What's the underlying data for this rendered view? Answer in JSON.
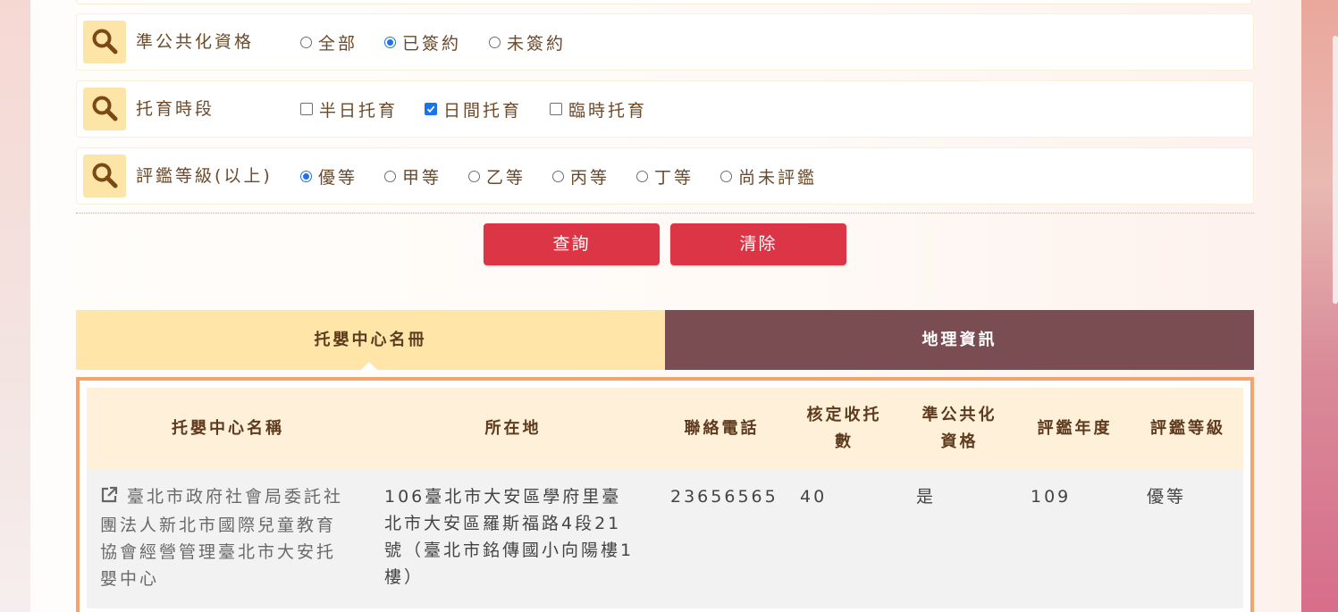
{
  "filters": [
    {
      "label": "準公共化資格",
      "type": "radio",
      "options": [
        {
          "label": "全部",
          "checked": false
        },
        {
          "label": "已簽約",
          "checked": true
        },
        {
          "label": "未簽約",
          "checked": false
        }
      ]
    },
    {
      "label": "托育時段",
      "type": "checkbox",
      "options": [
        {
          "label": "半日托育",
          "checked": false
        },
        {
          "label": "日間托育",
          "checked": true
        },
        {
          "label": "臨時托育",
          "checked": false
        }
      ]
    },
    {
      "label": "評鑑等級(以上)",
      "type": "radio",
      "options": [
        {
          "label": "優等",
          "checked": true
        },
        {
          "label": "甲等",
          "checked": false
        },
        {
          "label": "乙等",
          "checked": false
        },
        {
          "label": "丙等",
          "checked": false
        },
        {
          "label": "丁等",
          "checked": false
        },
        {
          "label": "尚未評鑑",
          "checked": false
        }
      ]
    }
  ],
  "buttons": {
    "search": "查詢",
    "clear": "清除"
  },
  "tabs": [
    {
      "label": "托嬰中心名冊",
      "active": true
    },
    {
      "label": "地理資訊",
      "active": false
    }
  ],
  "table": {
    "headers": {
      "name": "托嬰中心名稱",
      "location": "所在地",
      "phone": "聯絡電話",
      "capacity_1": "核定收托",
      "capacity_2": "數",
      "public_1": "準公共化",
      "public_2": "資格",
      "eval_year": "評鑑年度",
      "eval_level": "評鑑等級"
    },
    "rows": [
      {
        "name_lines": [
          "臺北市政府社會局委託社",
          "團法人新北市國際兒童教育",
          "協會經營管理臺北市大安托",
          "嬰中心"
        ],
        "location_lines": [
          "106臺北市大安區學府里臺",
          "北市大安區羅斯福路4段21",
          "號（臺北市銘傳國小向陽樓1",
          "樓）"
        ],
        "phone": "23656565",
        "capacity": "40",
        "public": "是",
        "eval_year": "109",
        "eval_level": "優等"
      }
    ]
  },
  "colors": {
    "accent_red": "#dc3545",
    "tab_active": "#ffe6a8",
    "tab_inactive": "#7a4d52",
    "table_border": "#f7a26a",
    "header_bg": "#fff0d9"
  },
  "icons": {
    "filter": "search-icon",
    "row_link": "external-link-icon"
  }
}
